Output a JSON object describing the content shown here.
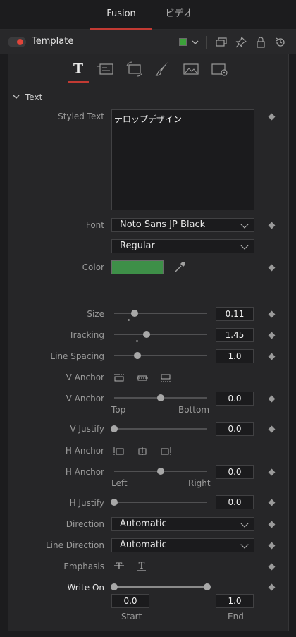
{
  "tabs": [
    {
      "label": "Fusion",
      "active": true
    },
    {
      "label": "ビデオ",
      "active": false
    }
  ],
  "node": {
    "title": "Template",
    "color_swatch": "#3ca23a"
  },
  "section": {
    "title": "Text"
  },
  "fields": {
    "styled_text_label": "Styled Text",
    "styled_text_value": "テロップデザイン",
    "font_label": "Font",
    "font_value": "Noto Sans JP Black",
    "font_style_value": "Regular",
    "color_label": "Color",
    "color_value": "#3e8f48",
    "size_label": "Size",
    "size_value": "0.11",
    "tracking_label": "Tracking",
    "tracking_value": "1.45",
    "line_spacing_label": "Line Spacing",
    "line_spacing_value": "1.0",
    "v_anchor_label": "V Anchor",
    "v_anchor_slider_label": "V Anchor",
    "v_anchor_value": "0.0",
    "v_anchor_min": "Top",
    "v_anchor_max": "Bottom",
    "v_justify_label": "V Justify",
    "v_justify_value": "0.0",
    "h_anchor_label": "H Anchor",
    "h_anchor_slider_label": "H Anchor",
    "h_anchor_value": "0.0",
    "h_anchor_min": "Left",
    "h_anchor_max": "Right",
    "h_justify_label": "H Justify",
    "h_justify_value": "0.0",
    "direction_label": "Direction",
    "direction_value": "Automatic",
    "line_direction_label": "Line Direction",
    "line_direction_value": "Automatic",
    "emphasis_label": "Emphasis",
    "write_on_label": "Write On",
    "write_on_start": "0.0",
    "write_on_end": "1.0",
    "write_on_start_label": "Start",
    "write_on_end_label": "End"
  },
  "sliders": {
    "size": 0.22,
    "tracking": 0.35,
    "line_spacing": 0.25,
    "v_anchor": 0.5,
    "v_justify": 0.0,
    "h_anchor": 0.5,
    "h_justify": 0.0,
    "write_on_start": 0.0,
    "write_on_end": 1.0
  }
}
